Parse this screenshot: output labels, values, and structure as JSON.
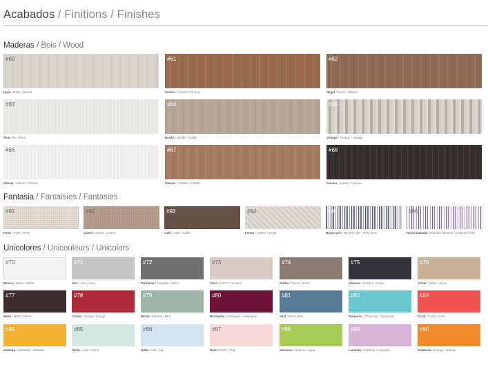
{
  "title": {
    "main": "Acabados",
    "rest": " / Finitions / Finishes"
  },
  "sections": [
    {
      "id": "wood",
      "heading": "Maderas",
      "heading_rest": " / Bois / Wood",
      "items": [
        {
          "code": "#60",
          "caption_main": "Haya",
          "caption_rest": " / Hêtre / Beech",
          "color": "#d9d3cd",
          "dark": false
        },
        {
          "code": "#61",
          "caption_main": "Cerezo",
          "caption_rest": " / Cerisier / Cherry",
          "color": "#9a6a4d",
          "dark": true
        },
        {
          "code": "#62",
          "caption_main": "Nogal",
          "caption_rest": " / Noyer / Walnut",
          "color": "#8e6a53",
          "dark": true
        },
        {
          "code": "#63",
          "caption_main": "Pino",
          "caption_rest": " / Pin / Pine",
          "color": "#eceae7",
          "dark": false
        },
        {
          "code": "#64",
          "caption_main": "Nordic",
          "caption_rest": " / Nordic / Nordic",
          "color": "#b5a595",
          "dark": true
        },
        {
          "code": "#65",
          "caption_main": "Vintage",
          "caption_rest": " / Vintage / Vintage",
          "color": "#c9c6bf",
          "dark": true
        },
        {
          "code": "#66",
          "caption_main": "Glaciar",
          "caption_rest": " / Glacier / Glacier",
          "color": "#f1f1f1",
          "dark": false
        },
        {
          "code": "#67",
          "caption_main": "Ontario",
          "caption_rest": " / Ontario / Ontario",
          "color": "#a47a60",
          "dark": true
        },
        {
          "code": "#68",
          "caption_main": "Guinea",
          "caption_rest": " / Guinée / Guinea",
          "color": "#35302e",
          "dark": true
        }
      ]
    },
    {
      "id": "fantasy",
      "heading": "Fantasia",
      "heading_rest": " / Fantaisies / Fantasies",
      "items": [
        {
          "code": "#91",
          "caption_main": "Perla",
          "caption_rest": " / Perle / Pearl",
          "color": "#e5dfd5",
          "dark": false
        },
        {
          "code": "#92",
          "caption_main": "Camel",
          "caption_rest": " / Camel / Camel",
          "color": "#b8a08f",
          "dark": false
        },
        {
          "code": "#93",
          "caption_main": "Café",
          "caption_rest": " / Café / Coffee",
          "color": "#6a534a",
          "dark": true
        },
        {
          "code": "#94",
          "caption_main": "Letras",
          "caption_rest": " / Lettres / Script",
          "color": "#dedbd4",
          "dark": false
        },
        {
          "code": "#95",
          "caption_main": "Rayas gris",
          "caption_rest": " / Rayures gris / Grey lines",
          "color": "#a3a3b0",
          "dark": true
        },
        {
          "code": "#96",
          "caption_main": "Rayas lavanda",
          "caption_rest": " / Rayures lavande / Lavander lines",
          "color": "#c6bfd4",
          "dark": false
        }
      ]
    },
    {
      "id": "unicolors",
      "heading": "Unicolores",
      "heading_rest": " / Unicouleurs / Unicolors",
      "items": [
        {
          "code": "#70",
          "caption_main": "Blanco",
          "caption_rest": " / Blanc / White",
          "color": "#f4f4f2",
          "dark": false
        },
        {
          "code": "#71",
          "caption_main": "Gris",
          "caption_rest": " / Gris / Grey",
          "color": "#c6c4c3",
          "dark": true
        },
        {
          "code": "#72",
          "caption_main": "Tormenta",
          "caption_rest": " / Tempête / Storm",
          "color": "#6f7071",
          "dark": true
        },
        {
          "code": "#73",
          "caption_main": "Coco",
          "caption_rest": " / Coco / Coconut",
          "color": "#d8cdc6",
          "dark": false
        },
        {
          "code": "#74",
          "caption_main": "Piedra",
          "caption_rest": " / Pierre / Stone",
          "color": "#8b7c73",
          "dark": true
        },
        {
          "code": "#75",
          "caption_main": "Vulcano",
          "caption_rest": " / Vulcain / Vulcan",
          "color": "#33343a",
          "dark": true
        },
        {
          "code": "#76",
          "caption_main": "Arena",
          "caption_rest": " / Sable / Sand",
          "color": "#c8b399",
          "dark": true
        },
        {
          "code": "#77",
          "caption_main": "Moka",
          "caption_rest": " / Moka / Moka",
          "color": "#3a2d2b",
          "dark": true
        },
        {
          "code": "#78",
          "caption_main": "Carmín",
          "caption_rest": " / Rouge / Rouge",
          "color": "#ae2a36",
          "dark": true
        },
        {
          "code": "#79",
          "caption_main": "Menta",
          "caption_rest": " / Menthe / Mint",
          "color": "#9eb5a8",
          "dark": true
        },
        {
          "code": "#80",
          "caption_main": "Berenjena",
          "caption_rest": " / Aubergine / Aubergine",
          "color": "#6c1235",
          "dark": true
        },
        {
          "code": "#81",
          "caption_main": "Azul",
          "caption_rest": " / Bleu / Blue",
          "color": "#577a96",
          "dark": true
        },
        {
          "code": "#82",
          "caption_main": "Turquesa",
          "caption_rest": " / Turquoise / Turquoise",
          "color": "#69c7cf",
          "dark": true
        },
        {
          "code": "#83",
          "caption_main": "Coral",
          "caption_rest": " / Coral / Coral",
          "color": "#ee5350",
          "dark": true
        },
        {
          "code": "#84",
          "caption_main": "Mostaza",
          "caption_rest": " / Moutarde / Mustard",
          "color": "#f2b233",
          "dark": true
        },
        {
          "code": "#85",
          "caption_main": "Verde",
          "caption_rest": " / Vert / Green",
          "color": "#d3e9df",
          "dark": false
        },
        {
          "code": "#86",
          "caption_main": "Nube",
          "caption_rest": " / Ciel / Sky",
          "color": "#d2e4ef",
          "dark": false
        },
        {
          "code": "#87",
          "caption_main": "Rosa",
          "caption_rest": " / Rose / Pink",
          "color": "#f6d8d9",
          "dark": false
        },
        {
          "code": "#88",
          "caption_main": "Manzana",
          "caption_rest": " / Pomme / Apple",
          "color": "#a7c957",
          "dark": true
        },
        {
          "code": "#89",
          "caption_main": "Lavanda",
          "caption_rest": " / Lavande / Lavander",
          "color": "#d9b3d7",
          "dark": true
        },
        {
          "code": "#90",
          "caption_main": "Calabaza",
          "caption_rest": " / Orange / Orange",
          "color": "#f08a2b",
          "dark": true
        }
      ]
    }
  ]
}
